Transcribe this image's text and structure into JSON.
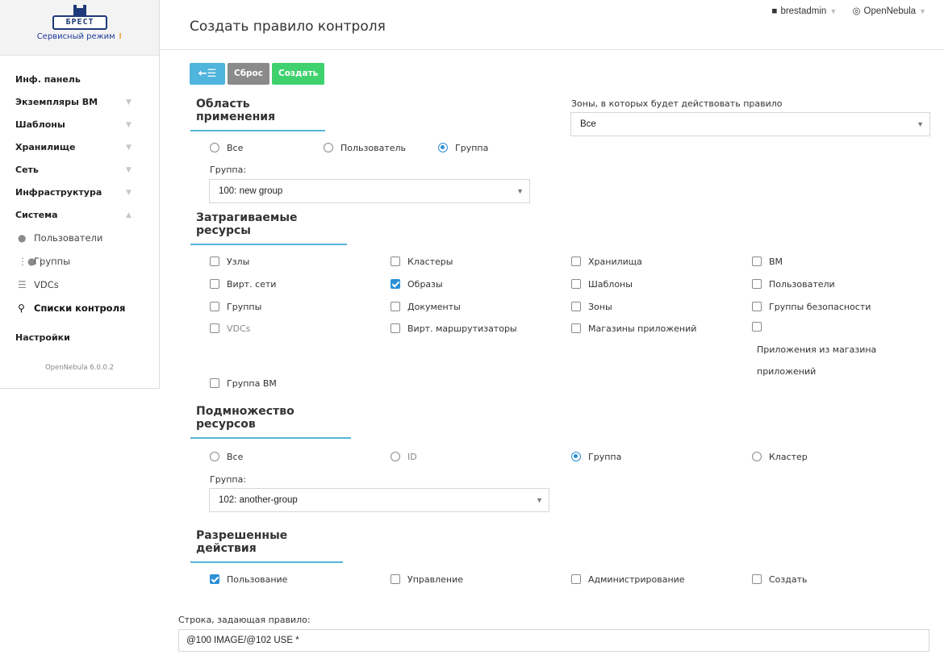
{
  "brand": {
    "logo_text": "БРЕСТ",
    "mode_text": "Сервисный режим",
    "mode_warning": "!"
  },
  "sidebar": {
    "items": [
      {
        "label": "Инф. панель"
      },
      {
        "label": "Экземпляры ВМ"
      },
      {
        "label": "Шаблоны"
      },
      {
        "label": "Хранилище"
      },
      {
        "label": "Сеть"
      },
      {
        "label": "Инфраструктура"
      },
      {
        "label": "Система"
      }
    ],
    "system_sub": [
      {
        "label": "Пользователи",
        "icon": "user-icon"
      },
      {
        "label": "Группы",
        "icon": "users-icon"
      },
      {
        "label": "VDCs",
        "icon": "vdc-icon"
      },
      {
        "label": "Списки контроля",
        "icon": "key-icon"
      }
    ],
    "settings_label": "Настройки",
    "version": "OpenNebula 6.0.0.2"
  },
  "header": {
    "title": "Создать правило контроля",
    "user": "brestadmin",
    "zone": "OpenNebula"
  },
  "toolbar": {
    "back_label": "←☰",
    "reset_label": "Сброс",
    "create_label": "Создать"
  },
  "scope": {
    "title": "Область применения",
    "zones_label": "Зоны, в которых будет действовать правило",
    "zones_value": "Все",
    "options": [
      "Все",
      "Пользователь",
      "Группа"
    ],
    "group_label": "Группа:",
    "group_value": "100: new group"
  },
  "resources": {
    "title": "Затрагиваемые ресурсы",
    "items": [
      "Узлы",
      "Кластеры",
      "Хранилища",
      "ВМ",
      "Вирт. сети",
      "Образы",
      "Шаблоны",
      "Пользователи",
      "Группы",
      "Документы",
      "Зоны",
      "Группы безопасности",
      "VDCs",
      "Вирт. маршрутизаторы",
      "Магазины приложений",
      "Приложения из магазина приложений",
      "Группа ВМ"
    ],
    "checked": [
      "Образы"
    ]
  },
  "subset": {
    "title": "Подмножество ресурсов",
    "options": [
      "Все",
      "ID",
      "Группа",
      "Кластер"
    ],
    "group_label": "Группа:",
    "group_value": "102: another-group"
  },
  "actions": {
    "title": "Разрешенные действия",
    "items": [
      "Пользование",
      "Управление",
      "Администрирование",
      "Создать"
    ]
  },
  "rule": {
    "label": "Строка, задающая правило:",
    "value": "@100 IMAGE/@102 USE *"
  }
}
